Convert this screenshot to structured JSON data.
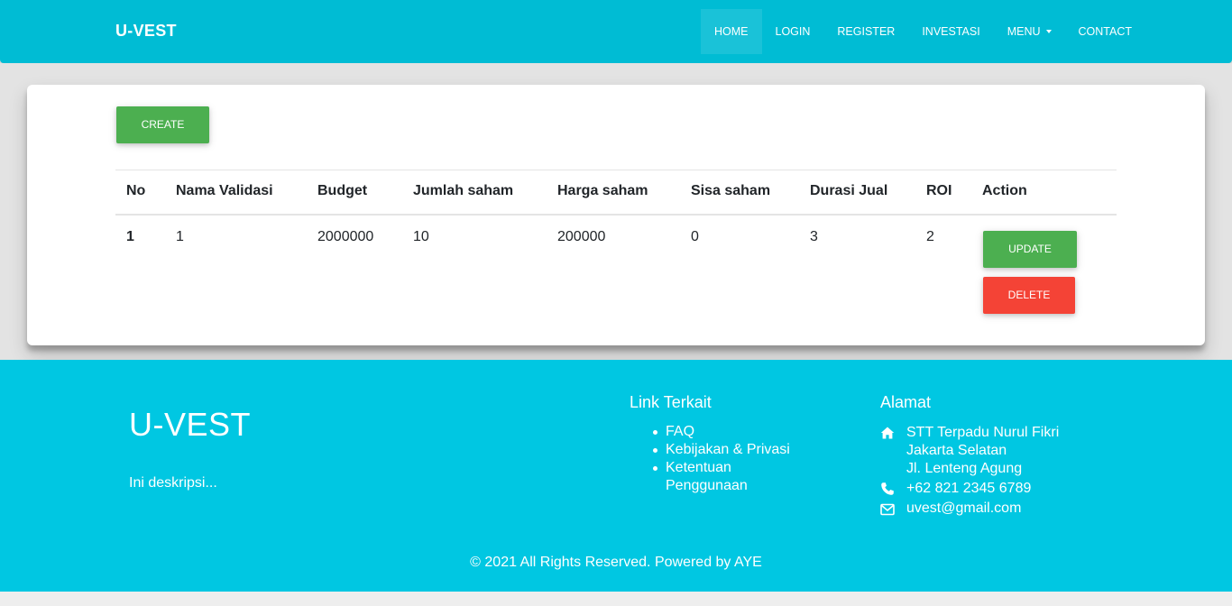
{
  "navbar": {
    "brand": "U-VEST",
    "items": [
      {
        "label": "HOME"
      },
      {
        "label": "LOGIN"
      },
      {
        "label": "REGISTER"
      },
      {
        "label": "INVESTASI"
      },
      {
        "label": "MENU"
      },
      {
        "label": "CONTACT"
      }
    ]
  },
  "actions": {
    "create_label": "CREATE"
  },
  "table": {
    "headers": [
      "No",
      "Nama Validasi",
      "Budget",
      "Jumlah saham",
      "Harga saham",
      "Sisa saham",
      "Durasi Jual",
      "ROI",
      "Action"
    ],
    "rows": [
      {
        "no": "1",
        "nama_validasi": "1",
        "budget": "2000000",
        "jumlah_saham": "10",
        "harga_saham": "200000",
        "sisa_saham": "0",
        "durasi_jual": "3",
        "roi": "2",
        "update_label": "UPDATE",
        "delete_label": "DELETE"
      }
    ]
  },
  "footer": {
    "title": "U-VEST",
    "description": "Ini deskripsi...",
    "links_heading": "Link Terkait",
    "links": [
      "FAQ",
      "Kebijakan & Privasi",
      "Ketentuan Penggunaan"
    ],
    "address_heading": "Alamat",
    "address_lines": [
      "STT Terpadu Nurul Fikri",
      "Jakarta Selatan",
      "Jl. Lenteng Agung"
    ],
    "phone": "+62 821 2345 6789",
    "email": "uvest@gmail.com",
    "copyright": "© 2021 All Rights Reserved. Powered by AYE"
  },
  "colors": {
    "navbar": "#00bcd4",
    "footer": "#00c7e2",
    "button_green": "#4caf50",
    "button_red": "#f44336"
  },
  "icons": {
    "address": "home-icon",
    "phone": "phone-icon",
    "email": "envelope-icon"
  }
}
